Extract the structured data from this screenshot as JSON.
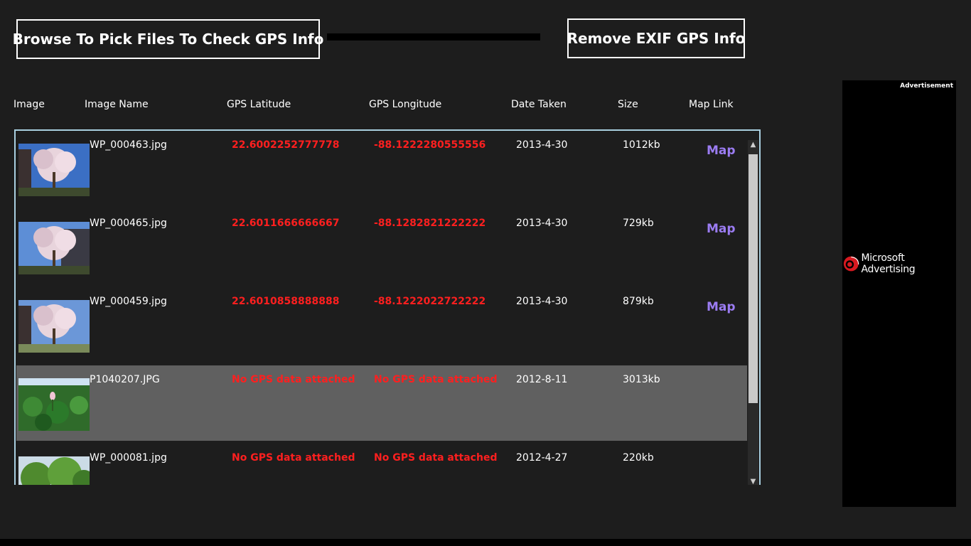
{
  "toolbar": {
    "browse_label": "Browse To Pick Files To Check GPS Info",
    "remove_label": "Remove EXIF GPS Info"
  },
  "columns": {
    "image": "Image",
    "image_name": "Image Name",
    "gps_latitude": "GPS Latitude",
    "gps_longitude": "GPS Longitude",
    "date_taken": "Date Taken",
    "size": "Size",
    "map_link": "Map Link"
  },
  "rows": [
    {
      "name": "WP_000463.jpg",
      "lat": "22.6002252777778",
      "lon": "-88.1222280555556",
      "date": "2013-4-30",
      "size": "1012kb",
      "map": "Map",
      "thumb": "blossom-tree-dark"
    },
    {
      "name": "WP_000465.jpg",
      "lat": "22.6011666666667",
      "lon": "-88.1282821222222",
      "date": "2013-4-30",
      "size": "729kb",
      "map": "Map",
      "thumb": "blossom-tree-building"
    },
    {
      "name": "WP_000459.jpg",
      "lat": "22.6010858888888",
      "lon": "-88.1222022722222",
      "date": "2013-4-30",
      "size": "879kb",
      "map": "Map",
      "thumb": "blossom-tree-lawn"
    },
    {
      "name": "P1040207.JPG",
      "lat": "No GPS data attached",
      "lon": "No GPS data attached",
      "date": "2012-8-11",
      "size": "3013kb",
      "map": "",
      "thumb": "lotus-pond",
      "selected": true
    },
    {
      "name": "WP_000081.jpg",
      "lat": "No GPS data attached",
      "lon": "No GPS data attached",
      "date": "2012-4-27",
      "size": "220kb",
      "map": "",
      "thumb": "green-trees"
    }
  ],
  "progress": {
    "value": 0
  },
  "ad": {
    "label": "Advertisement",
    "brand": "Microsoft Advertising"
  },
  "colors": {
    "background": "#1d1d1d",
    "gps_text": "#ff1f1f",
    "map_link": "#9b7cf2",
    "list_border": "#a9cfe0",
    "selected_row": "#606060"
  }
}
